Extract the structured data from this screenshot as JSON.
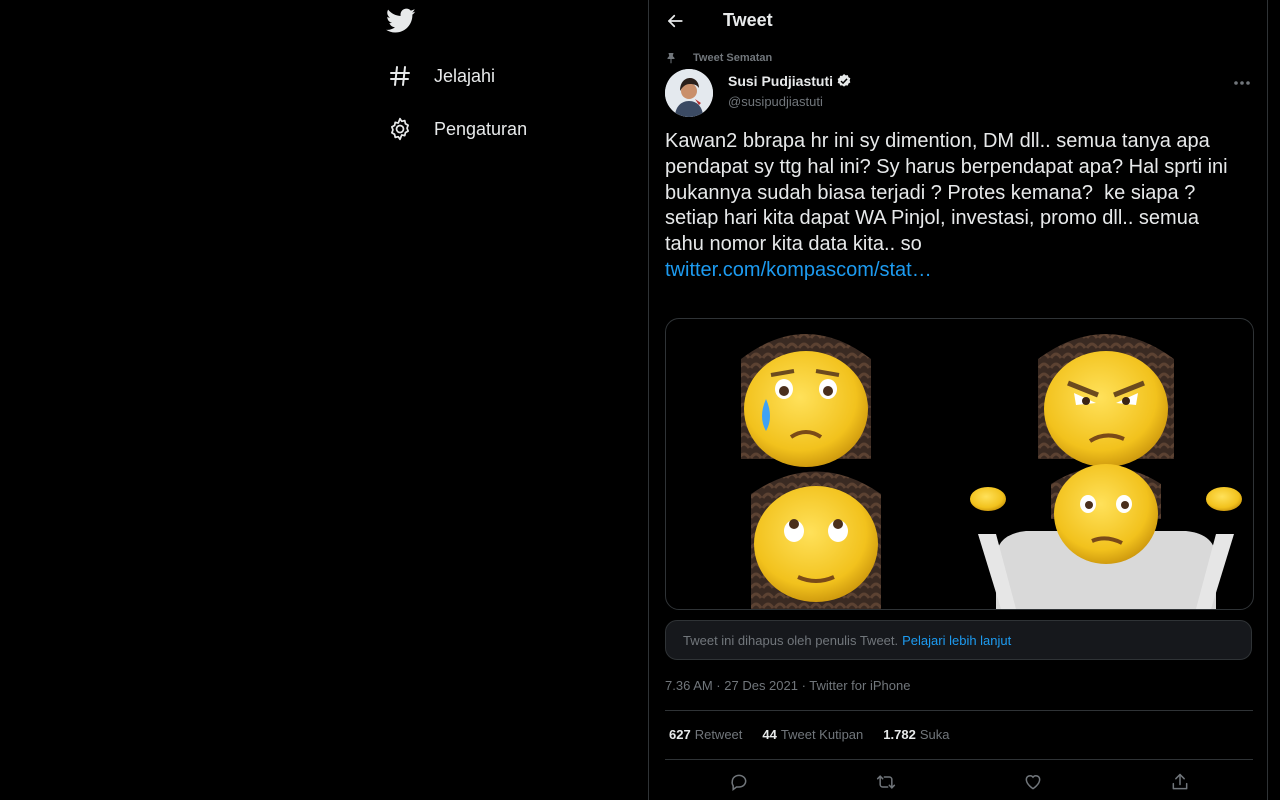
{
  "nav": {
    "items": [
      {
        "label": "Jelajahi",
        "icon": "hashtag-icon"
      },
      {
        "label": "Pengaturan",
        "icon": "gear-icon"
      }
    ]
  },
  "header": {
    "title": "Tweet"
  },
  "tweet": {
    "pinned_label": "Tweet Sematan",
    "author_name": "Susi Pudjiastuti",
    "author_handle": "@susipudjiastuti",
    "text": "Kawan2 bbrapa hr ini sy dimention, DM dll.. semua tanya apa pendapat sy ttg hal ini? Sy harus berpendapat apa? Hal sprti ini bukannya sudah biasa terjadi ? Protes kemana?  ke siapa ?setiap hari kita dapat WA Pinjol, investasi, promo dll.. semua tahu nomor kita data kita.. so",
    "link": "twitter.com/kompascom/stat…",
    "deleted_notice": "Tweet ini dihapus oleh penulis Tweet.",
    "learn_more": "Pelajari lebih lanjut",
    "timestamp": "7.36 AM · 27 Des 2021 · Twitter for iPhone",
    "retweets_count": "627",
    "retweets_label": "Retweet",
    "quotes_count": "44",
    "quotes_label": "Tweet Kutipan",
    "likes_count": "1.782",
    "likes_label": "Suka"
  },
  "colors": {
    "background": "#000000",
    "text": "#e7e9ea",
    "muted": "#71767b",
    "accent": "#1d9bf0",
    "border": "#2f3336"
  }
}
